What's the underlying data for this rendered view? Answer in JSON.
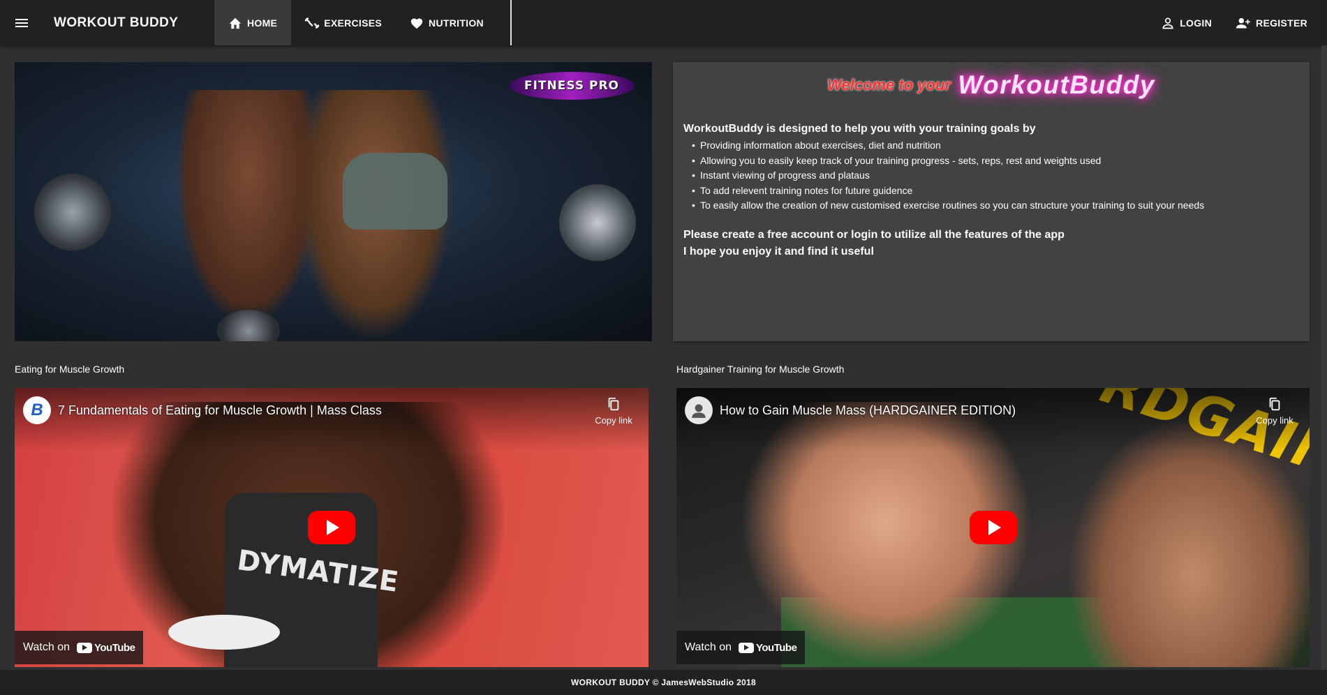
{
  "header": {
    "app_title": "WORKOUT BUDDY",
    "nav": [
      {
        "label": "HOME",
        "icon": "home-icon",
        "active": true
      },
      {
        "label": "EXERCISES",
        "icon": "dumbbell-icon",
        "active": false
      },
      {
        "label": "NUTRITION",
        "icon": "heart-icon",
        "active": false
      }
    ],
    "right_nav": [
      {
        "label": "LOGIN",
        "icon": "person-icon"
      },
      {
        "label": "REGISTER",
        "icon": "person-add-icon"
      }
    ]
  },
  "hero": {
    "logo_text": "FITNESS PRO"
  },
  "info": {
    "welcome_prefix": "Welcome to your",
    "welcome_brand": "WorkoutBuddy",
    "lead": "WorkoutBuddy is designed to help you with your training goals by",
    "bullets": [
      "Providing information about exercises, diet and nutrition",
      "Allowing you to easily keep track of your training progress - sets, reps, rest and weights used",
      "Instant viewing of progress and plataus",
      "To add relevent training notes for future guidence",
      "To easily allow the creation of new customised exercise routines so you can structure your training to suit your needs"
    ],
    "cta_line1": "Please create a free account or login to utilize all the features of the app",
    "cta_line2": "I hope you enjoy it and find it useful"
  },
  "videos": [
    {
      "section_label": "Eating for Muscle Growth",
      "title": "7 Fundamentals of Eating for Muscle Growth | Mass Class",
      "channel_initial": "B",
      "shirt_text": "DYMATIZE",
      "copy_link": "Copy link",
      "watch_on": "Watch on",
      "yt_word": "YouTube"
    },
    {
      "section_label": "Hardgainer Training for Muscle Growth",
      "title": "How to Gain Muscle Mass (HARDGAINER EDITION)",
      "overlay_text": "RDGAINER",
      "copy_link": "Copy link",
      "watch_on": "Watch on",
      "yt_word": "YouTube"
    }
  ],
  "footer": {
    "text": "WORKOUT BUDDY © JamesWebStudio 2018"
  },
  "colors": {
    "topbar": "#212121",
    "background": "#303030",
    "card": "#424242",
    "welcome_red": "#ff3030",
    "neon_pink": "#ff2dd1",
    "youtube_red": "#ff0000"
  }
}
